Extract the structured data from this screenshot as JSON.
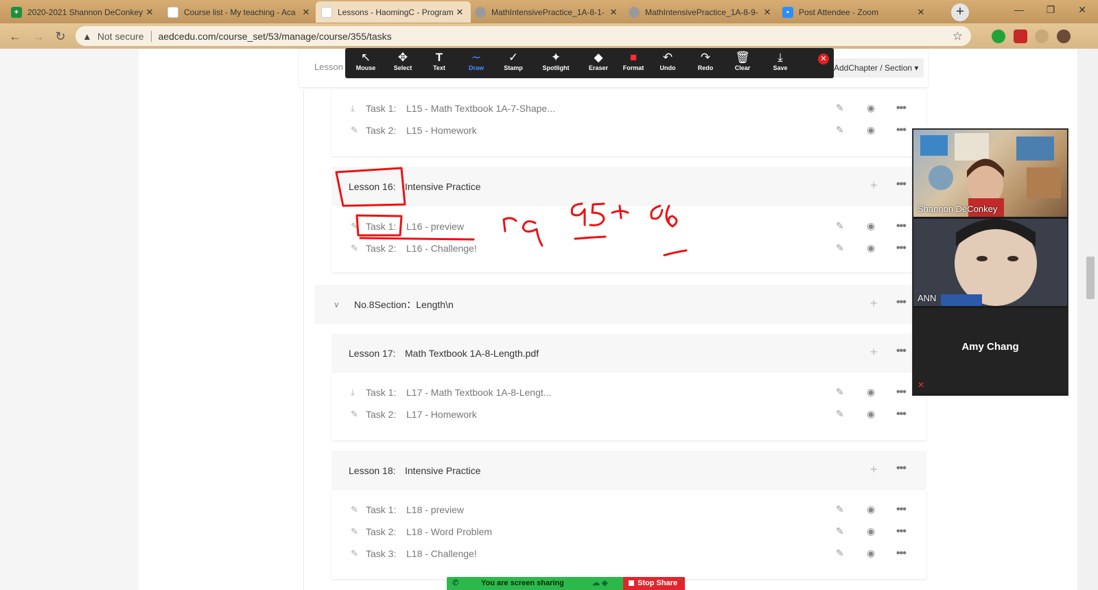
{
  "tabs": [
    {
      "title": "2020-2021 Shannon DeConkey",
      "color": "#1e8e3e",
      "glyph": "+"
    },
    {
      "title": "Course list - My teaching - Aca",
      "color": "#ffffff",
      "glyph": ""
    },
    {
      "title": "Lessons - HaomingC - Program",
      "color": "#ffffff",
      "glyph": ""
    },
    {
      "title": "MathIntensivePractice_1A-8-1-",
      "color": "#8a8a8a",
      "glyph": ""
    },
    {
      "title": "MathIntensivePractice_1A-8-9-",
      "color": "#8a8a8a",
      "glyph": ""
    },
    {
      "title": "Post Attendee - Zoom",
      "color": "#2d8cff",
      "glyph": ""
    }
  ],
  "addressbar": {
    "not_secure": "Not secure",
    "url": "aedcedu.com/course_set/53/manage/course/355/tasks"
  },
  "header": {
    "lesson_label": "Lesson",
    "add_chapter": "AddChapter / Section"
  },
  "annotate_tools": [
    {
      "name": "mouse",
      "label": "Mouse",
      "glyph": "↖"
    },
    {
      "name": "select",
      "label": "Select",
      "glyph": "✥"
    },
    {
      "name": "text",
      "label": "Text",
      "glyph": "T"
    },
    {
      "name": "draw",
      "label": "Draw",
      "glyph": "∼"
    },
    {
      "name": "stamp",
      "label": "Stamp",
      "glyph": "✓"
    },
    {
      "name": "spotlight",
      "label": "Spotlight",
      "glyph": "✦"
    },
    {
      "name": "eraser",
      "label": "Eraser",
      "glyph": "◆"
    },
    {
      "name": "format",
      "label": "Format",
      "glyph": "■"
    },
    {
      "name": "undo",
      "label": "Undo",
      "glyph": "↶"
    },
    {
      "name": "redo",
      "label": "Redo",
      "glyph": "↷"
    },
    {
      "name": "clear",
      "label": "Clear",
      "glyph": "🗑"
    },
    {
      "name": "save",
      "label": "Save",
      "glyph": "⤓"
    }
  ],
  "lesson15": {
    "tasks": [
      {
        "key": "Task 1:",
        "title": "L15 - Math Textbook 1A-7-Shape..."
      },
      {
        "key": "Task 2:",
        "title": "L15 - Homework"
      }
    ]
  },
  "lesson16": {
    "key": "Lesson 16:",
    "title": "Intensive Practice",
    "tasks": [
      {
        "key": "Task 1:",
        "title": "L16 - preview"
      },
      {
        "key": "Task 2:",
        "title": "L16 - Challenge!"
      }
    ]
  },
  "section8": {
    "title": "No.8Section：Length\\n"
  },
  "lesson17": {
    "key": "Lesson 17:",
    "title": "Math Textbook 1A-8-Length.pdf",
    "tasks": [
      {
        "key": "Task 1:",
        "title": "L17 - Math Textbook 1A-8-Lengt..."
      },
      {
        "key": "Task 2:",
        "title": "L17 - Homework"
      }
    ]
  },
  "lesson18": {
    "key": "Lesson 18:",
    "title": "Intensive Practice",
    "tasks": [
      {
        "key": "Task 1:",
        "title": "L18 - preview"
      },
      {
        "key": "Task 2:",
        "title": "L18 - Word Problem"
      },
      {
        "key": "Task 3:",
        "title": "L18 - Challenge!"
      }
    ]
  },
  "video": {
    "p1": "Shannon DeConkey",
    "p2": "ANN",
    "p3": "Amy Chang"
  },
  "share": {
    "label": "You are screen sharing",
    "stop": "Stop Share"
  },
  "colors": {
    "ink": "#ee1111",
    "share_green": "#2db84b",
    "stop_red": "#e0262d"
  }
}
